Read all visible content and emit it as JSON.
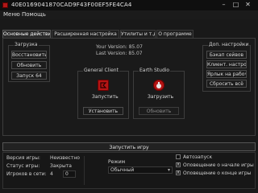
{
  "window": {
    "title": "40E0169041870CAD9F43F00EF5FE4CA4",
    "minimize_glyph": "–",
    "maximize_glyph": "□",
    "close_glyph": "✕"
  },
  "menu": [
    "Меню",
    "Помощь"
  ],
  "tabs": [
    "Основные действия",
    "Расширенная настройка",
    "Утилиты и т.д.",
    "О программе"
  ],
  "left_group": {
    "title": "Загрузка",
    "buttons": [
      "Восстановить",
      "Обновить",
      "Запуск 64"
    ]
  },
  "versions": {
    "your_version": "Your Version: 85.07",
    "last_version": "Last Version: 85.07"
  },
  "launch_group": {
    "title": "General Client",
    "caption": "Запустить",
    "button": "Установить"
  },
  "extra_group": {
    "title": "Earth Studio",
    "caption": "Загрузить",
    "button": "Обновить"
  },
  "right_group": {
    "title": "Доп. настройки",
    "buttons": [
      "Бэкап сейвов",
      "Клиент. настройки",
      "Ярлык на рабочий",
      "Сбросить всё"
    ]
  },
  "main_button": "Запустить игру",
  "status": {
    "rows": [
      {
        "label": "Версия игры:",
        "value": "Неизвестно"
      },
      {
        "label": "Статус игры:",
        "value": "Закрыта"
      },
      {
        "label": "Игроков в сети:",
        "value": "4"
      }
    ],
    "spinner_value": "0",
    "mode_label": "Режим",
    "mode_value": "Обычный",
    "checks": [
      {
        "label": "Автозапуск",
        "checked": false
      },
      {
        "label": "Оповещение о начале игры",
        "checked": true
      },
      {
        "label": "Оповещение о конце игры",
        "checked": true
      }
    ]
  },
  "colors": {
    "accent_red": "#b51515",
    "background": "#191919",
    "border": "#3d3d3d"
  }
}
